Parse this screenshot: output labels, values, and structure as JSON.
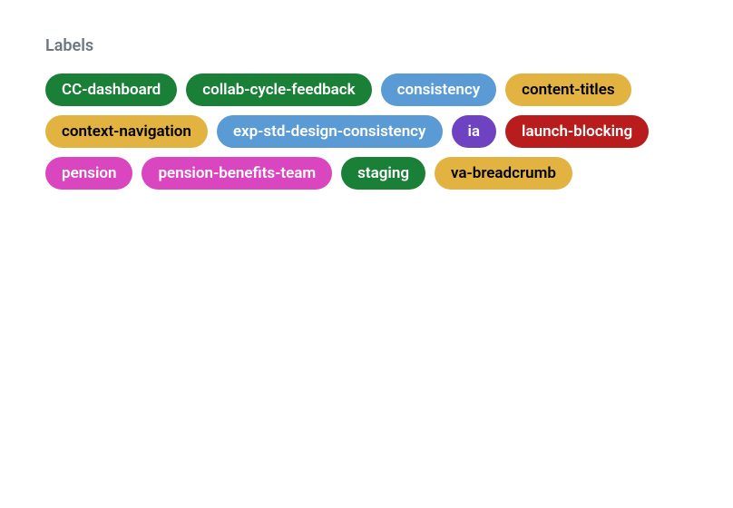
{
  "section": {
    "title": "Labels"
  },
  "labels": [
    {
      "id": "cc-dashboard",
      "text": "CC-dashboard",
      "bg": "#1a7f37",
      "color": "#ffffff"
    },
    {
      "id": "collab-cycle-feedback",
      "text": "collab-cycle-feedback",
      "bg": "#1a7f37",
      "color": "#ffffff"
    },
    {
      "id": "consistency",
      "text": "consistency",
      "bg": "#5b9bd5",
      "color": "#ffffff"
    },
    {
      "id": "content-titles",
      "text": "content-titles",
      "bg": "#e3b341",
      "color": "#000000"
    },
    {
      "id": "context-navigation",
      "text": "context-navigation",
      "bg": "#e3b341",
      "color": "#000000"
    },
    {
      "id": "exp-std-design-consistency",
      "text": "exp-std-design-consistency",
      "bg": "#5b9bd5",
      "color": "#ffffff"
    },
    {
      "id": "ia",
      "text": "ia",
      "bg": "#6f42c1",
      "color": "#ffffff"
    },
    {
      "id": "launch-blocking",
      "text": "launch-blocking",
      "bg": "#b91c1c",
      "color": "#ffffff"
    },
    {
      "id": "pension",
      "text": "pension",
      "bg": "#d946c0",
      "color": "#ffffff"
    },
    {
      "id": "pension-benefits-team",
      "text": "pension-benefits-team",
      "bg": "#d946c0",
      "color": "#ffffff"
    },
    {
      "id": "staging",
      "text": "staging",
      "bg": "#1a7f37",
      "color": "#ffffff"
    },
    {
      "id": "va-breadcrumb",
      "text": "va-breadcrumb",
      "bg": "#e3b341",
      "color": "#000000"
    }
  ]
}
